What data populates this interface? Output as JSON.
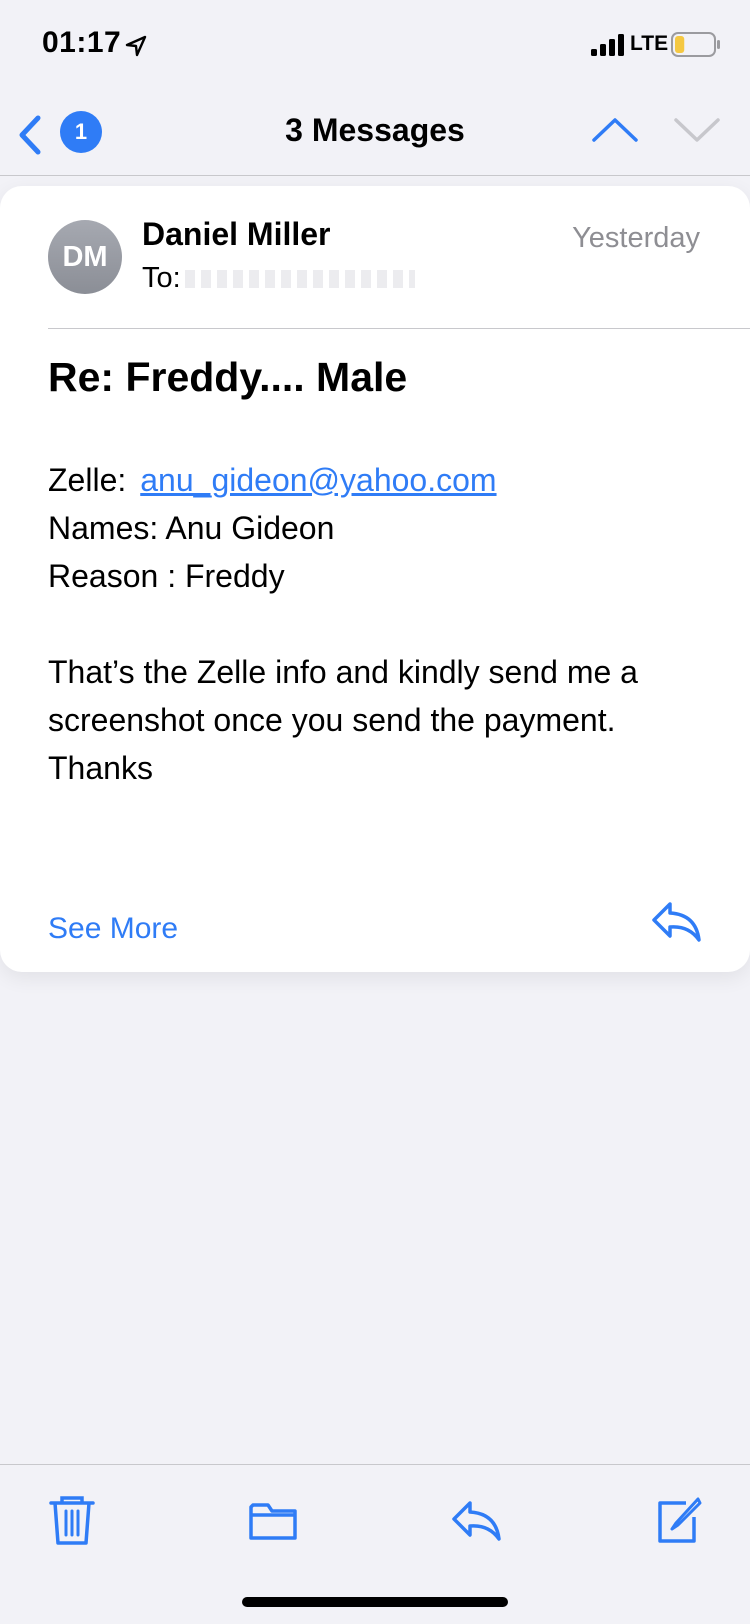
{
  "status_bar": {
    "time": "01:17",
    "network": "LTE",
    "battery_level": 0.25
  },
  "nav": {
    "badge_count": "1",
    "title": "3 Messages"
  },
  "message": {
    "avatar_initials": "DM",
    "sender": "Daniel Miller",
    "date": "Yesterday",
    "to_label": "To:",
    "subject": "Re: Freddy.... Male",
    "zelle_label": "Zelle:",
    "zelle_email": "anu_gideon@yahoo.com",
    "names_line": "Names: Anu Gideon",
    "reason_line": "Reason : Freddy",
    "paragraph": "That’s the Zelle info and kindly send me a screenshot once you send the payment.",
    "signoff": "Thanks",
    "see_more": "See More"
  },
  "colors": {
    "accent": "#2f7cf6",
    "muted": "#8e8e93",
    "battery_fill": "#f5c842"
  },
  "icons": [
    "location-arrow-icon",
    "signal-icon",
    "battery-icon",
    "chevron-left-icon",
    "chevron-up-icon",
    "chevron-down-icon",
    "reply-icon",
    "trash-icon",
    "folder-icon",
    "compose-icon"
  ]
}
